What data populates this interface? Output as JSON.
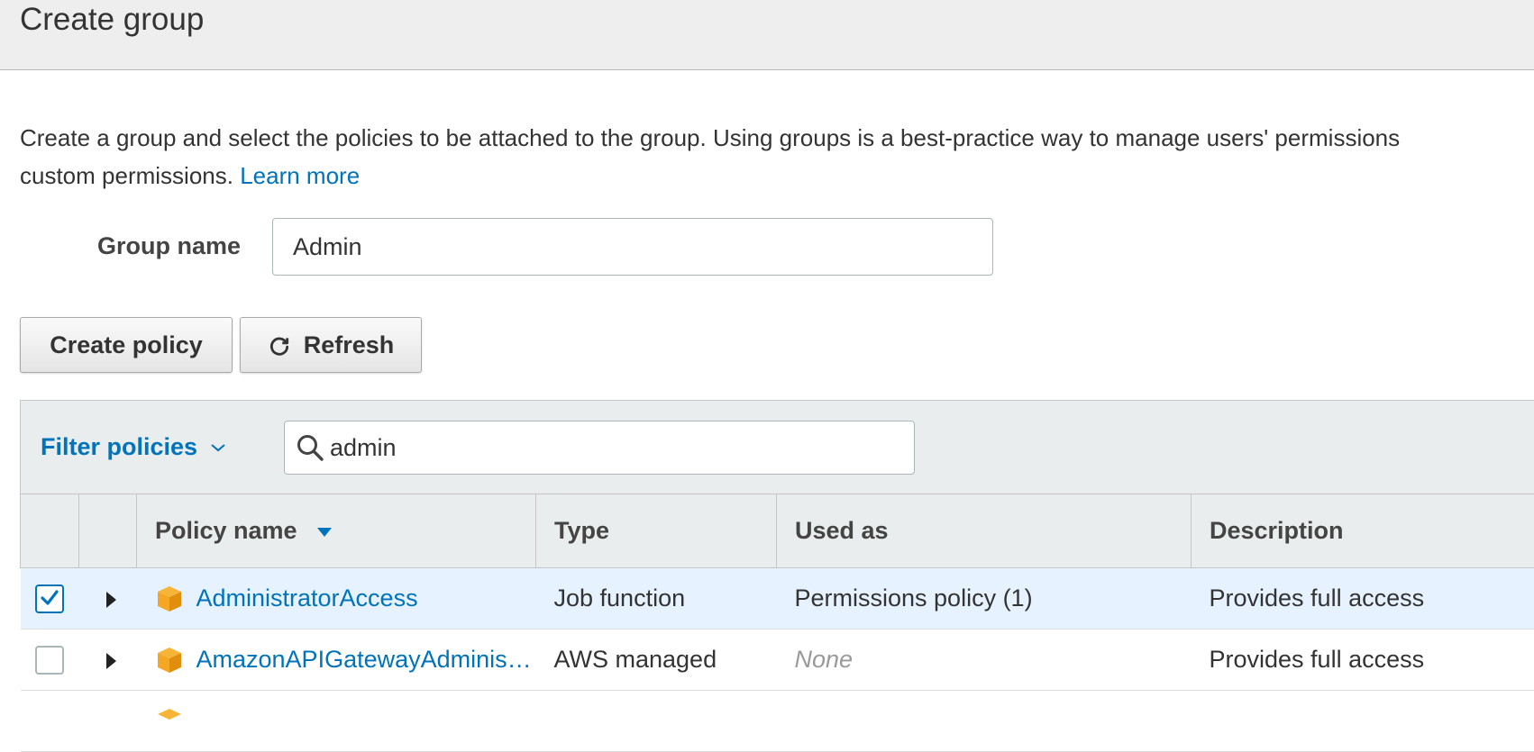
{
  "header": {
    "title": "Create group"
  },
  "intro": {
    "line1": "Create a group and select the policies to be attached to the group. Using groups is a best-practice way to manage users' permissions",
    "line2": "custom permissions.",
    "learn_more": "Learn more"
  },
  "form": {
    "group_name_label": "Group name",
    "group_name_value": "Admin"
  },
  "actions": {
    "create_policy_label": "Create policy",
    "refresh_label": "Refresh"
  },
  "filter": {
    "dropdown_label": "Filter policies",
    "search_value": "admin"
  },
  "table": {
    "columns": [
      "Policy name",
      "Type",
      "Used as",
      "Description"
    ],
    "rows": [
      {
        "checked": true,
        "name": "AdministratorAccess",
        "type": "Job function",
        "used_as": "Permissions policy (1)",
        "description": "Provides full access"
      },
      {
        "checked": false,
        "name": "AmazonAPIGatewayAdminis…",
        "type": "AWS managed",
        "used_as": "None",
        "description": "Provides full access"
      }
    ]
  },
  "colors": {
    "link": "#0073bb",
    "header_bg": "#eeeeee",
    "selected_row_bg": "#e6f2ff",
    "policy_icon": "#f5a623"
  },
  "icons": [
    "refresh-icon",
    "chevron-down-icon",
    "search-icon",
    "sort-desc-icon",
    "checkmark-icon",
    "expand-caret-icon",
    "policy-box-icon"
  ]
}
